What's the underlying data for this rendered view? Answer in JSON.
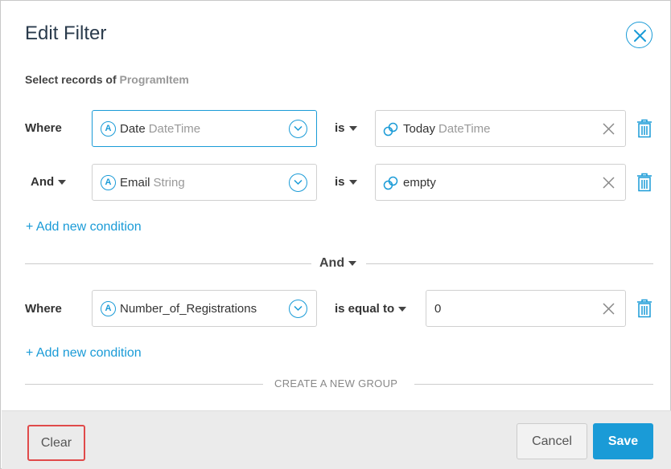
{
  "dialog": {
    "title": "Edit Filter",
    "subtitle_prefix": "Select records of",
    "entity": "ProgramItem"
  },
  "group1": {
    "conditions": [
      {
        "connector": "Where",
        "field_name": "Date",
        "field_type": "DateTime",
        "field_icon": "A",
        "operator": "is",
        "value_name": "Today",
        "value_type": "DateTime"
      },
      {
        "connector": "And",
        "field_name": "Email",
        "field_type": "String",
        "field_icon": "A",
        "operator": "is",
        "value_name": "empty",
        "value_type": ""
      }
    ],
    "add_condition": "+ Add new condition"
  },
  "group_operator": "And",
  "group2": {
    "conditions": [
      {
        "connector": "Where",
        "field_name": "Number_of_Registrations",
        "field_icon": "A",
        "operator": "is equal to",
        "value": "0"
      }
    ],
    "add_condition": "+ Add new condition"
  },
  "create_group": "CREATE A NEW GROUP",
  "footer": {
    "clear": "Clear",
    "cancel": "Cancel",
    "save": "Save"
  },
  "colors": {
    "accent": "#1a9bd7",
    "highlight": "#e04a4a"
  },
  "icons": [
    "close-icon",
    "field-type-icon",
    "chevron-down-icon",
    "link-icon",
    "clear-x-icon",
    "trash-icon",
    "caret-down-icon"
  ]
}
